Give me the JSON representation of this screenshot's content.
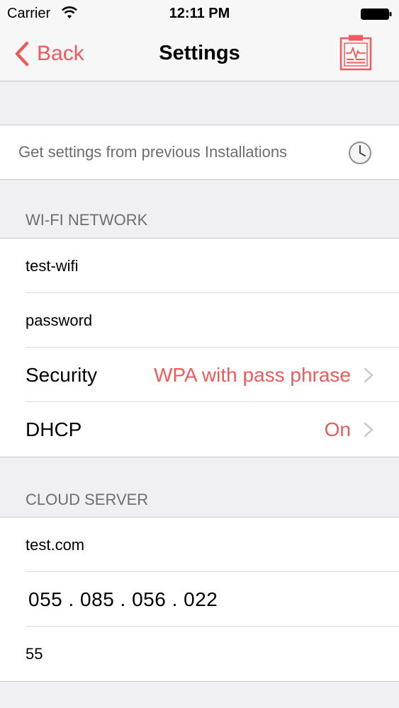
{
  "status_bar": {
    "carrier": "Carrier",
    "time": "12:11 PM"
  },
  "nav": {
    "back_label": "Back",
    "title": "Settings",
    "right_icon": "clipboard-chart-icon"
  },
  "previous_installs": {
    "label": "Get settings from previous Installations",
    "icon": "clock-icon"
  },
  "wifi": {
    "header": "WI-FI NETWORK",
    "ssid": "test-wifi",
    "password": "password",
    "security_label": "Security",
    "security_value": "WPA with pass phrase",
    "dhcp_label": "DHCP",
    "dhcp_value": "On"
  },
  "cloud": {
    "header": "CLOUD SERVER",
    "host": "test.com",
    "ip": "055 . 085 . 056 . 022",
    "port": "55"
  },
  "colors": {
    "accent": "#ef5a5a",
    "background": "#efeff4",
    "header_text": "#6d6d72"
  }
}
